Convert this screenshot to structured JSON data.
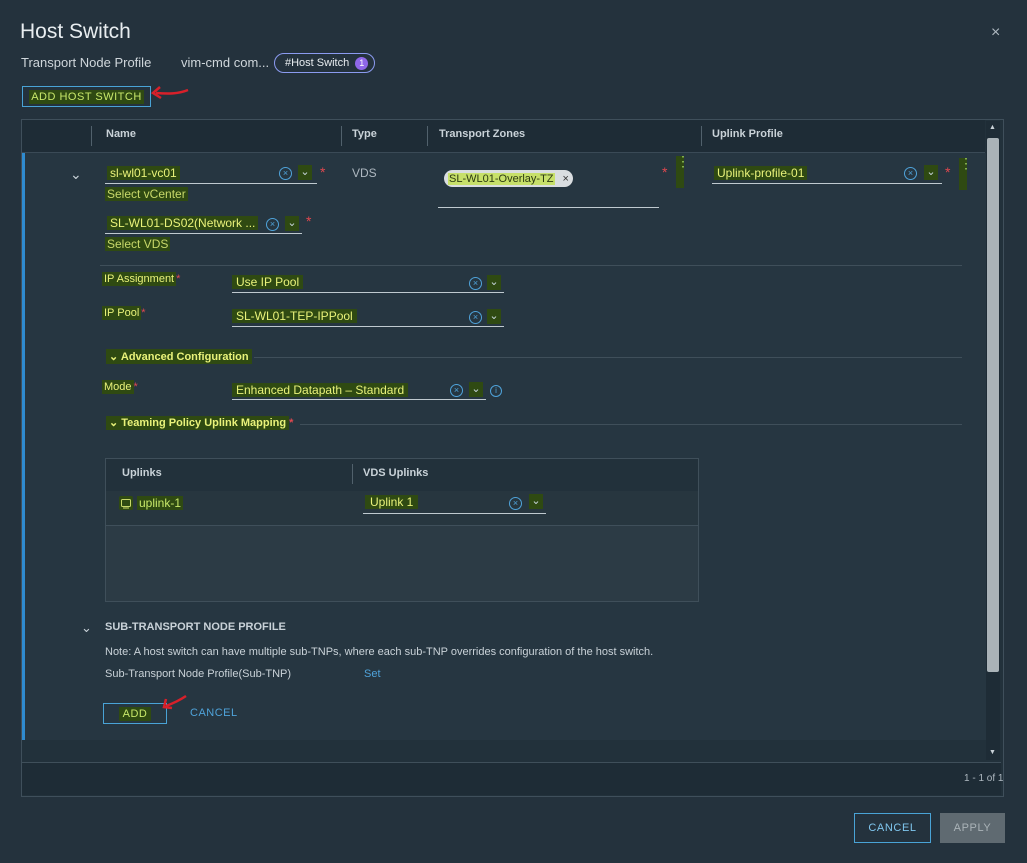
{
  "dialog": {
    "title": "Host Switch",
    "close_symbol": "×"
  },
  "breadcrumb": {
    "profile_label": "Transport Node Profile",
    "profile_name": "vim-cmd com...",
    "pill_label": "#Host Switch",
    "pill_count": "1"
  },
  "toolbar": {
    "add_host_switch": "ADD HOST SWITCH"
  },
  "table": {
    "columns": [
      "Name",
      "Type",
      "Transport Zones",
      "Uplink Profile"
    ],
    "row": {
      "vcenter_value": "sl-wl01-vc01",
      "vcenter_hint": "Select vCenter",
      "vds_value": "SL-WL01-DS02(Network ...",
      "vds_hint": "Select VDS",
      "type": "VDS",
      "transport_zone_tag": "SL-WL01-Overlay-TZ",
      "uplink_profile_value": "Uplink-profile-01"
    },
    "pagination": "1 - 1 of 1"
  },
  "form": {
    "ip_assignment_label": "IP Assignment",
    "ip_assignment_value": "Use IP Pool",
    "ip_pool_label": "IP Pool",
    "ip_pool_value": "SL-WL01-TEP-IPPool",
    "advanced_label": "Advanced Configuration",
    "mode_label": "Mode",
    "mode_value": "Enhanced Datapath – Standard",
    "teaming_label": "Teaming Policy Uplink Mapping"
  },
  "uplinks_table": {
    "col_uplinks": "Uplinks",
    "col_vds_uplinks": "VDS Uplinks",
    "rows": [
      {
        "uplink": "uplink-1",
        "vds_uplink": "Uplink 1"
      }
    ]
  },
  "sub_tnp": {
    "heading": "SUB-TRANSPORT NODE PROFILE",
    "note": "Note: A host switch can have multiple sub-TNPs, where each sub-TNP overrides configuration of the host switch.",
    "label": "Sub-Transport Node Profile(Sub-TNP)",
    "set_link": "Set"
  },
  "row_actions": {
    "add": "ADD",
    "cancel": "CANCEL"
  },
  "footer_actions": {
    "cancel": "CANCEL",
    "apply": "APPLY"
  },
  "symbols": {
    "required": "*",
    "clear": "×",
    "chevron_down": "⌄",
    "info": "i",
    "kebab": "⋮"
  },
  "colors": {
    "accent": "#49a3d6",
    "required": "#e0484f",
    "highlight_bg": "#2f4a12",
    "highlight_text": "#e9f27a",
    "badge": "#8f67e8"
  }
}
